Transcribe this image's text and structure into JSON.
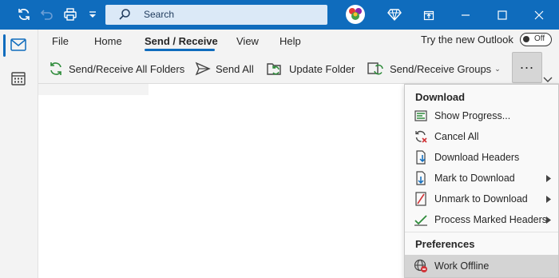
{
  "titlebar": {
    "search_placeholder": "Search",
    "icons": [
      "sync-icon",
      "undo-icon",
      "print-icon",
      "customize-toolbar-icon",
      "search-icon",
      "avatar",
      "premium-diamond-icon",
      "restore-icon",
      "minimize-icon",
      "maximize-icon",
      "close-icon"
    ],
    "accent": "#0f6cbd"
  },
  "rail": {
    "items": [
      "mail-icon",
      "calendar-icon"
    ],
    "selected": "mail"
  },
  "ribbon": {
    "tabs": [
      "File",
      "Home",
      "Send / Receive",
      "View",
      "Help"
    ],
    "active_tab": "Send / Receive",
    "try_new": "Try the new Outlook",
    "toggle_label": "Off",
    "commands": {
      "send_receive_all": "Send/Receive All Folders",
      "send_all": "Send All",
      "update_folder": "Update Folder",
      "groups": "Send/Receive Groups"
    },
    "overflow": "..."
  },
  "menu": {
    "download_header": "Download",
    "items": [
      {
        "label": "Show Progress...",
        "submenu": false
      },
      {
        "label": "Cancel All",
        "submenu": false
      },
      {
        "label": "Download Headers",
        "submenu": false
      },
      {
        "label": "Mark to Download",
        "submenu": true
      },
      {
        "label": "Unmark to Download",
        "submenu": true
      },
      {
        "label": "Process Marked Headers",
        "submenu": true
      }
    ],
    "preferences_header": "Preferences",
    "work_offline": "Work Offline"
  }
}
